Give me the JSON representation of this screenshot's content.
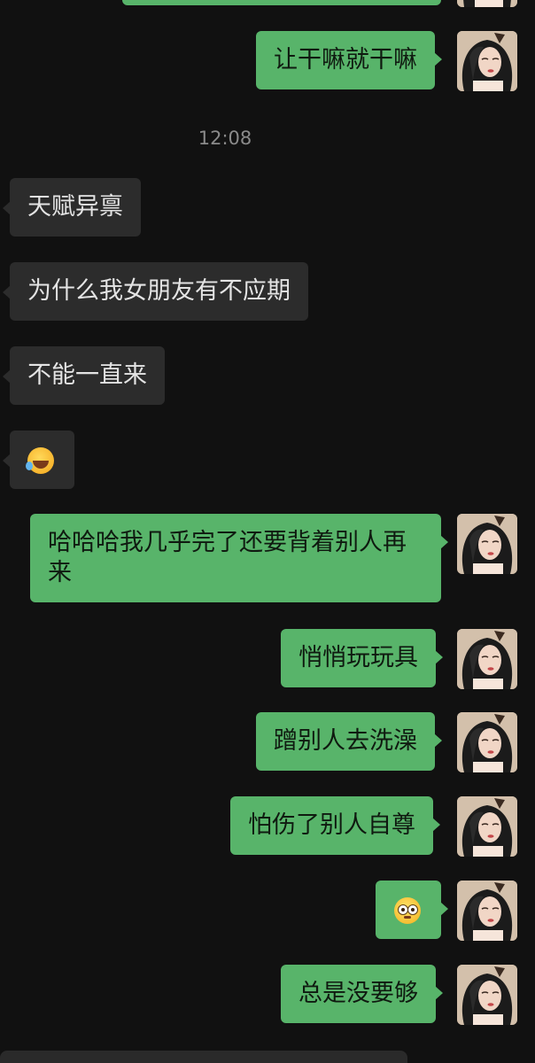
{
  "messages": [
    {
      "id": "m0",
      "side": "out",
      "text": ""
    },
    {
      "id": "m1",
      "side": "out",
      "text": "让干嘛就干嘛"
    },
    {
      "id": "m3",
      "side": "in",
      "text": "天赋异禀"
    },
    {
      "id": "m4",
      "side": "in",
      "text": "为什么我女朋友有不应期"
    },
    {
      "id": "m5",
      "side": "in",
      "text": "不能一直来"
    },
    {
      "id": "m6",
      "side": "in",
      "emoji": "laughing-crying-emoji"
    },
    {
      "id": "m7",
      "side": "out",
      "text": "哈哈哈我几乎完了还要背着别人再来"
    },
    {
      "id": "m8",
      "side": "out",
      "text": "悄悄玩玩具"
    },
    {
      "id": "m9",
      "side": "out",
      "text": "蹭别人去洗澡"
    },
    {
      "id": "m10",
      "side": "out",
      "text": "怕伤了别人自尊"
    },
    {
      "id": "m11",
      "side": "out",
      "emoji": "flushed-face-emoji"
    },
    {
      "id": "m12",
      "side": "out",
      "text": "总是没要够"
    }
  ],
  "timestamp": "12:08",
  "colors": {
    "background": "#111111",
    "outgoing_bubble": "#58b46a",
    "incoming_bubble": "#2c2c2c"
  }
}
